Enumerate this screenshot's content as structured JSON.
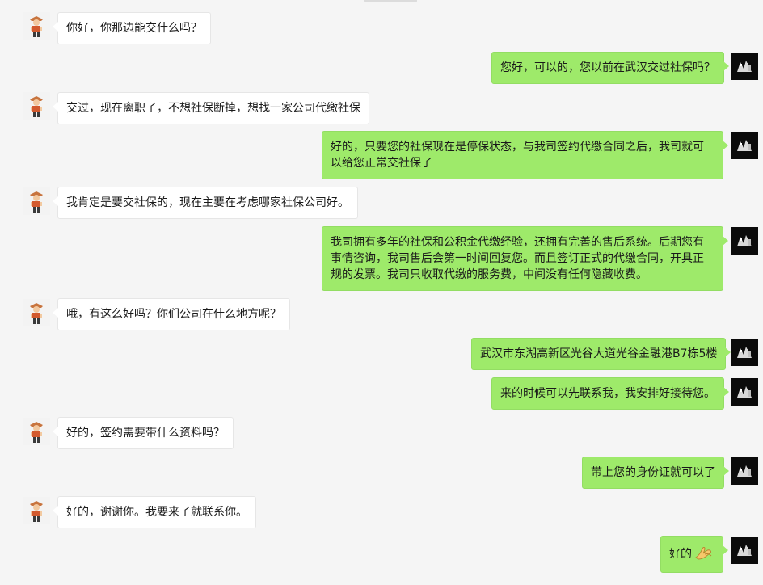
{
  "conversation": {
    "messages": [
      {
        "side": "left",
        "text": "你好，你那边能交什么吗？"
      },
      {
        "side": "right",
        "text": "您好，可以的，您以前在武汉交过社保吗？"
      },
      {
        "side": "left",
        "text": "交过，现在离职了，不想社保断掉，想找一家公司代缴社保"
      },
      {
        "side": "right",
        "text": "好的，只要您的社保现在是停保状态，与我司签约代缴合同之后，我司就可以给您正常交社保了"
      },
      {
        "side": "left",
        "text": "我肯定是要交社保的，现在主要在考虑哪家社保公司好。"
      },
      {
        "side": "right",
        "text": "我司拥有多年的社保和公积金代缴经验，还拥有完善的售后系统。后期您有事情咨询，我司售后会第一时间回复您。而且签订正式的代缴合同，开具正规的发票。我司只收取代缴的服务费，中间没有任何隐藏收费。"
      },
      {
        "side": "left",
        "text": "哦，有这么好吗？你们公司在什么地方呢？"
      },
      {
        "side": "right",
        "text": "武汉市东湖高新区光谷大道光谷金融港B7栋5楼"
      },
      {
        "side": "right",
        "text": "来的时候可以先联系我，我安排好接待您。"
      },
      {
        "side": "left",
        "text": "好的，签约需要带什么资料吗？"
      },
      {
        "side": "right",
        "text": "带上您的身份证就可以了"
      },
      {
        "side": "left",
        "text": "好的，谢谢你。我要来了就联系你。"
      },
      {
        "side": "right",
        "text": "好的",
        "emoji": "ok-hand-emoji"
      }
    ]
  },
  "colors": {
    "background": "#f5f5f5",
    "sent_bubble": "#9eea6a",
    "received_bubble": "#ffffff",
    "right_avatar_bg": "#0b0b0b"
  }
}
